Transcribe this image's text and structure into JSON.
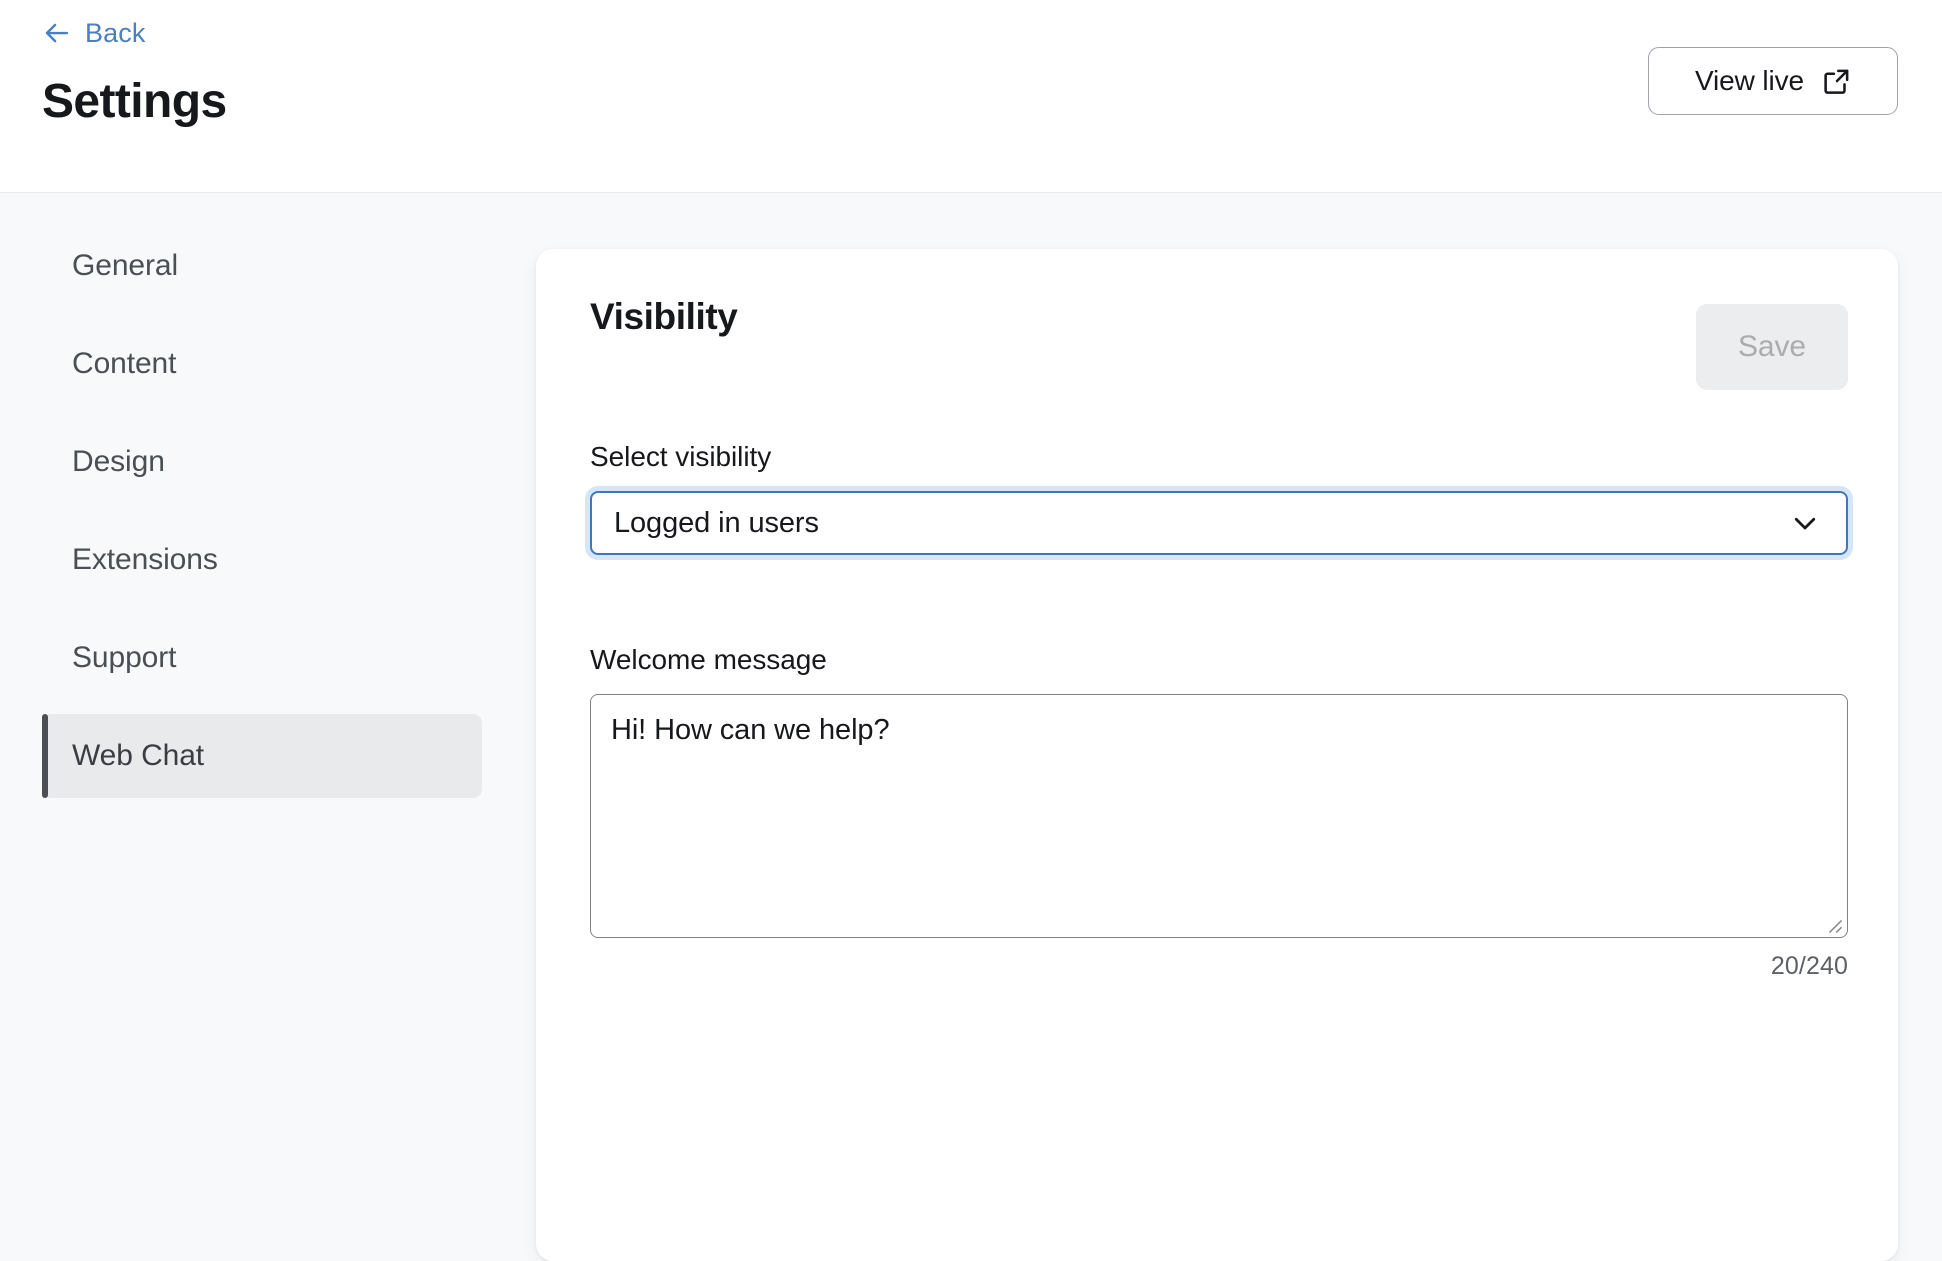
{
  "header": {
    "back_label": "Back",
    "back_icon": "arrow-left-icon",
    "title": "Settings",
    "view_live_label": "View live",
    "view_live_icon": "external-link-icon",
    "link_color": "#4a7fc1"
  },
  "sidebar": {
    "items": [
      {
        "label": "General",
        "active": false
      },
      {
        "label": "Content",
        "active": false
      },
      {
        "label": "Design",
        "active": false
      },
      {
        "label": "Extensions",
        "active": false
      },
      {
        "label": "Support",
        "active": false
      },
      {
        "label": "Web Chat",
        "active": true
      }
    ],
    "active_item": "Web Chat",
    "active_bg": "#e9eaec",
    "active_accent": "#4b4f55"
  },
  "card": {
    "title": "Visibility",
    "save_label": "Save",
    "save_disabled": true,
    "save_bg": "#ebedef",
    "save_text_color": "#aaacb0",
    "fields": {
      "visibility": {
        "label": "Select visibility",
        "selected_value": "Logged in users",
        "chevron_icon": "chevron-down-icon",
        "focused": true,
        "focus_ring_color": "#d7e6f6",
        "focus_border_color": "#3e78b8",
        "options": [
          "Logged in users"
        ]
      },
      "welcome": {
        "label": "Welcome message",
        "value": "Hi! How can we help?",
        "placeholder": "",
        "counter": "20/240",
        "char_count": 20,
        "char_limit": 240,
        "resize_icon": "resize-handle-icon"
      }
    }
  },
  "theme": {
    "page_bg": "#f8f9fb",
    "card_bg": "#ffffff",
    "text_primary": "#16181c",
    "text_secondary": "#4a4e55"
  }
}
